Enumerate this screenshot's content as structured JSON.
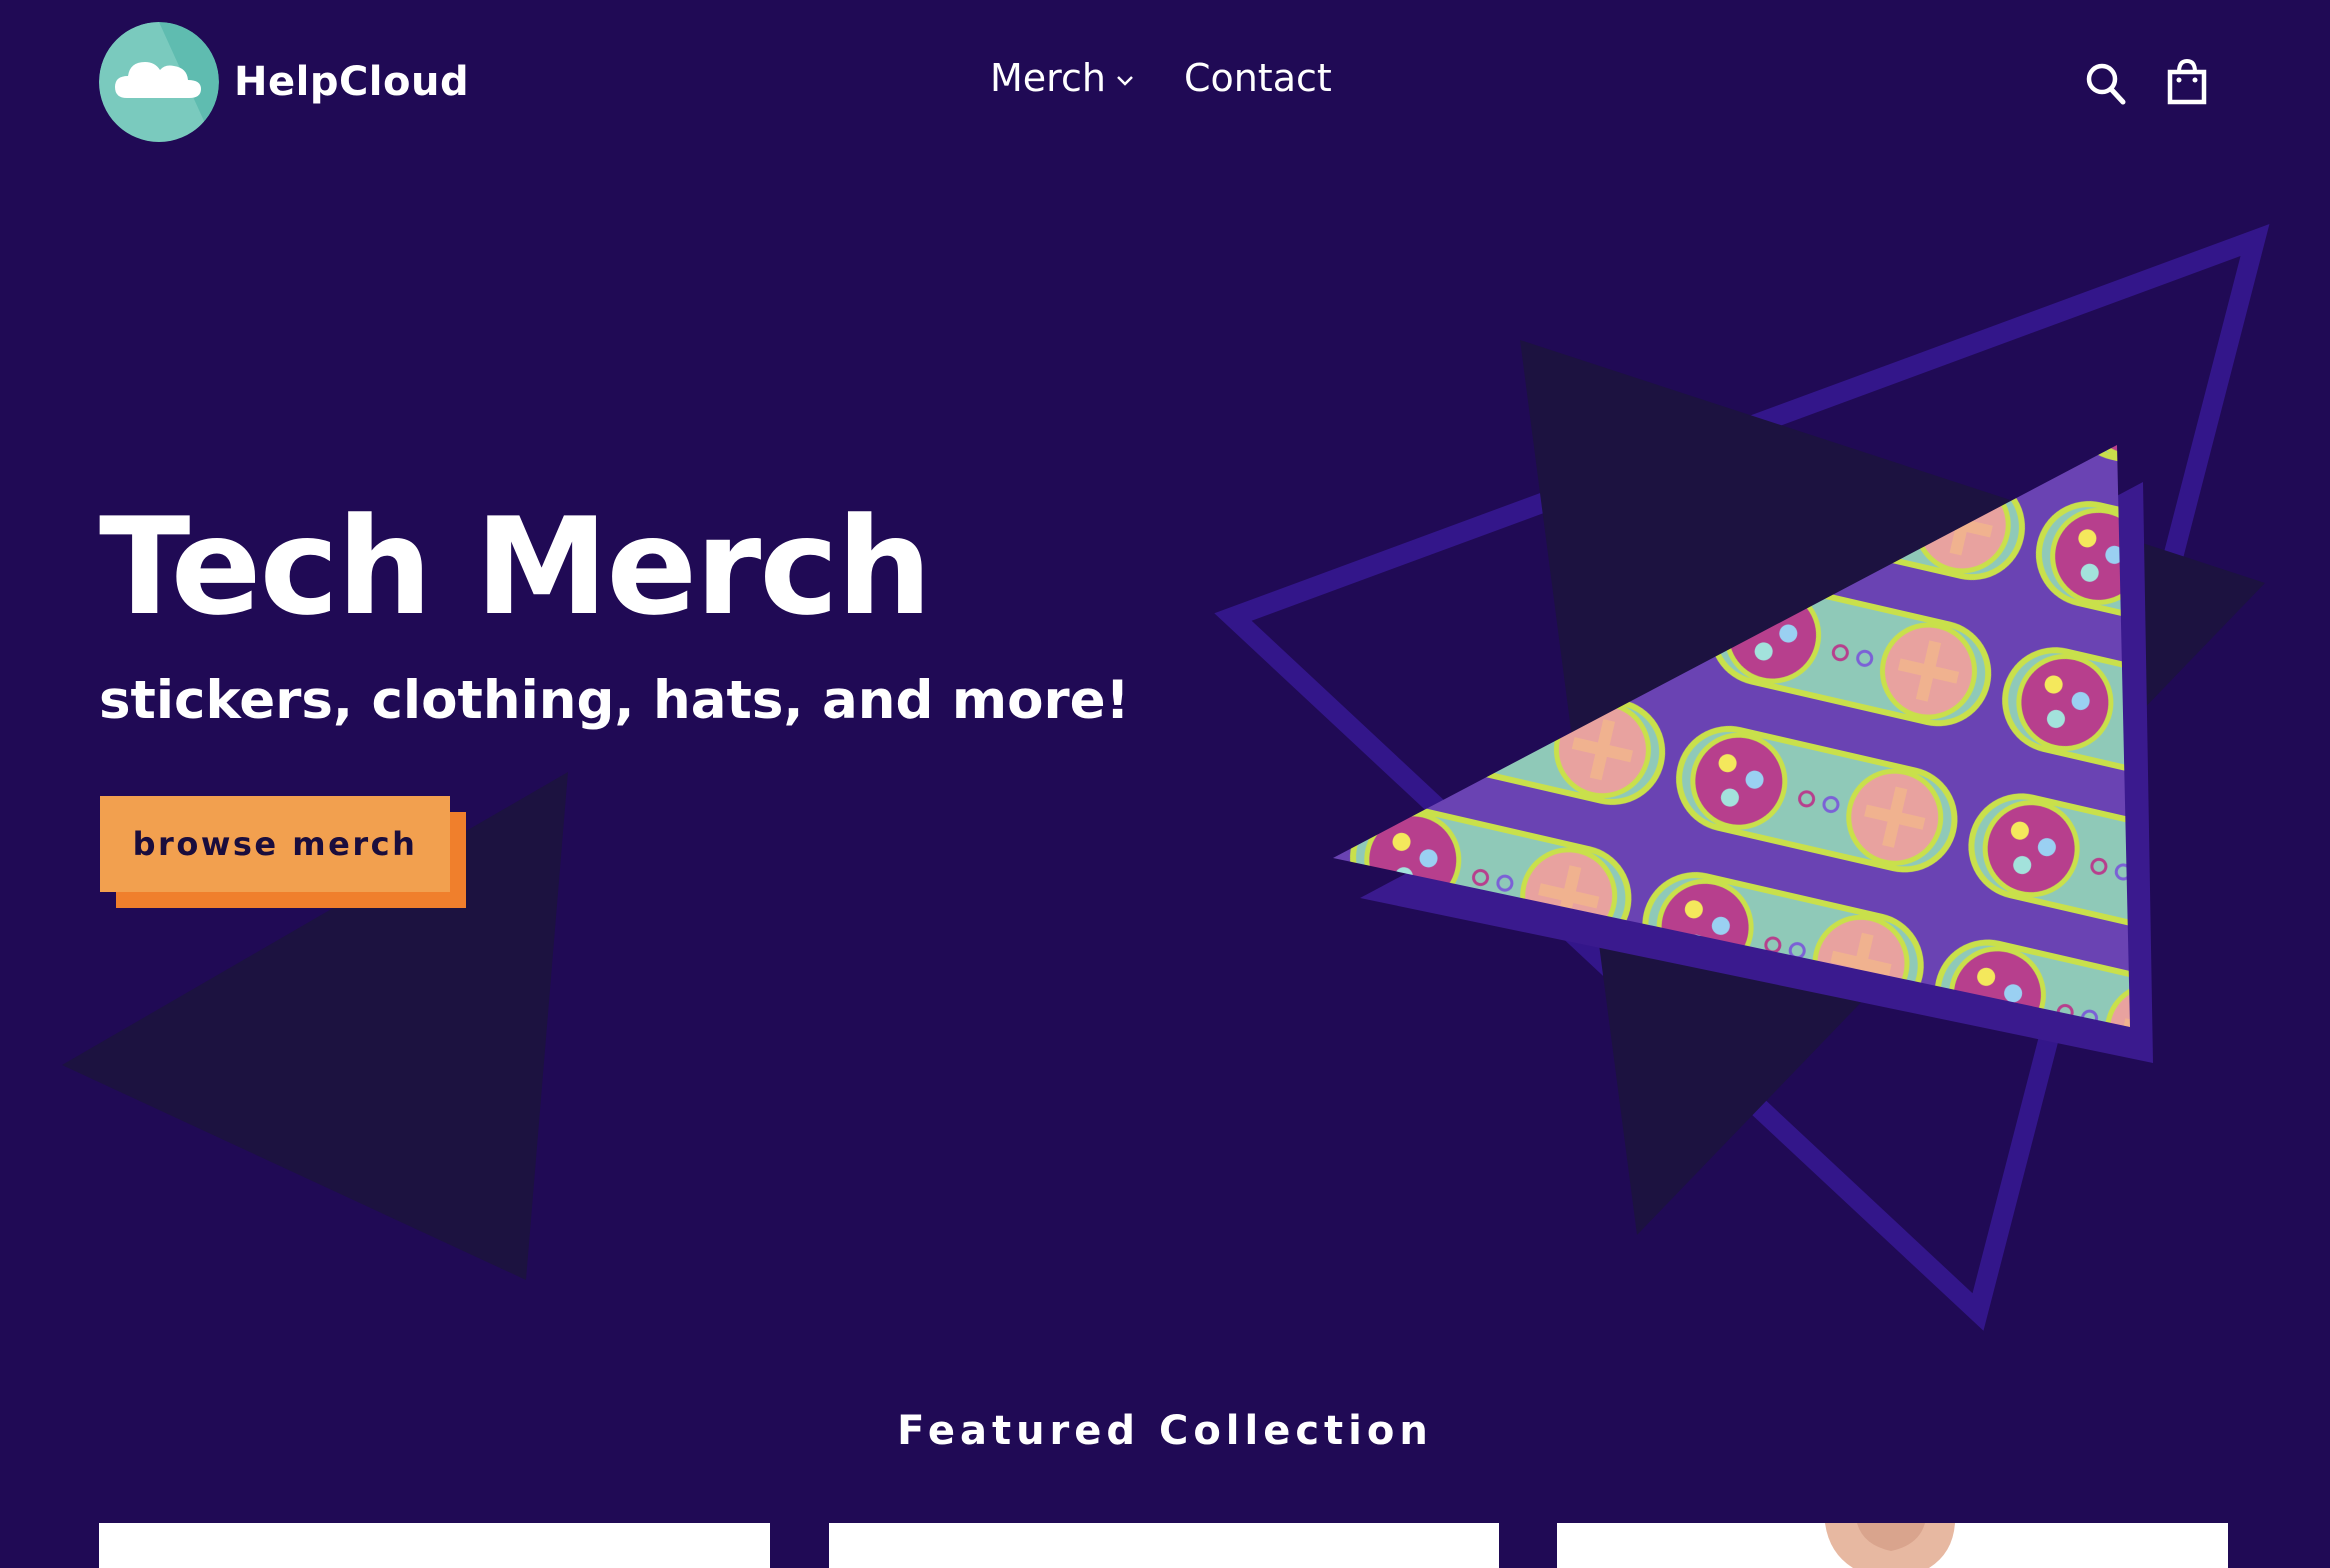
{
  "brand": {
    "name": "HelpCloud"
  },
  "nav": {
    "items": [
      {
        "label": "Merch",
        "dropdown": true
      },
      {
        "label": "Contact"
      }
    ]
  },
  "header_icons": [
    "search-icon",
    "cart-icon"
  ],
  "hero": {
    "title": "Tech Merch",
    "subtitle": "stickers, clothing, hats, and more!",
    "cta_label": "browse merch"
  },
  "featured": {
    "title": "Featured Collection",
    "cards": 3
  },
  "colors": {
    "background": "#200a55",
    "accent": "#f2a04f",
    "accent_shadow": "#f07f2c",
    "button_text": "#1a0d3d",
    "text": "#ffffff"
  }
}
